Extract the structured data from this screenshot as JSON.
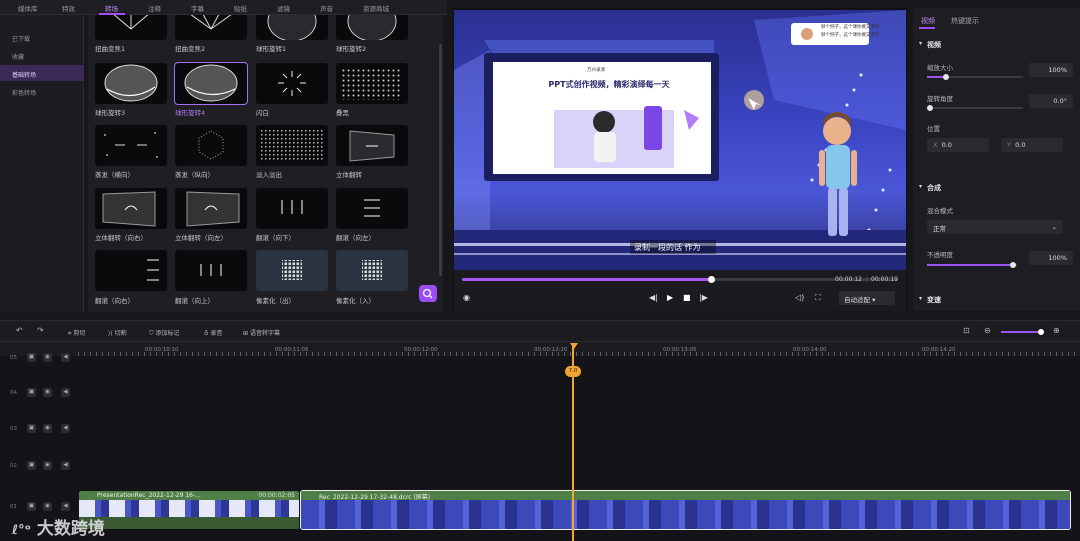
{
  "tabs": [
    "媒体库",
    "特效",
    "转场",
    "注释",
    "字幕",
    "贴纸",
    "滤镜",
    "声音",
    "资源商城"
  ],
  "categories": [
    "已下载",
    "收藏",
    "基础转场",
    "彩色转场"
  ],
  "transitions": [
    {
      "label": "扭曲变焦1"
    },
    {
      "label": "扭曲变焦2"
    },
    {
      "label": "球形旋转1"
    },
    {
      "label": "球形旋转2"
    },
    {
      "label": "球形旋转3"
    },
    {
      "label": "球形旋转4"
    },
    {
      "label": "闪白"
    },
    {
      "label": "叠黑"
    },
    {
      "label": "蒸发（横向）"
    },
    {
      "label": "蒸发（纵向）"
    },
    {
      "label": "淡入淡出"
    },
    {
      "label": "立体翻转"
    },
    {
      "label": "立体翻转（向右）"
    },
    {
      "label": "立体翻转（向左）"
    },
    {
      "label": "翻滚（向下）"
    },
    {
      "label": "翻滚（向左）"
    },
    {
      "label": "翻滚（向右）"
    },
    {
      "label": "翻滚（向上）"
    },
    {
      "label": "像素化（出）"
    },
    {
      "label": "像素化（入）"
    }
  ],
  "video": {
    "slide_title": "PPT式创作视频，精彩演绎每一天",
    "logo_text": "万兴录演",
    "subtitle": "录制一段的话 作为",
    "bubble_line1": "够个例子，这个课你要又求印",
    "bubble_line2": "够个例子，这个课你要又求印"
  },
  "playback": {
    "current": "00:00:12",
    "total": "00:00:19",
    "fit": "自动适配",
    "progress": 0.57
  },
  "inspector": {
    "tabs": [
      "视频",
      "热键提示"
    ],
    "section_video": "视频",
    "scale_label": "缩放大小",
    "scale_value": "100%",
    "rotate_label": "旋转角度",
    "rotate_value": "0.0°",
    "position_label": "位置",
    "x_label": "X",
    "x_value": "0.0",
    "y_label": "Y",
    "y_value": "0.0",
    "section_composite": "合成",
    "blend_label": "混合模式",
    "blend_value": "正常",
    "opacity_label": "不透明度",
    "opacity_value": "100%",
    "section_speed": "变速"
  },
  "toolbar": {
    "cut": "剪切",
    "split": "切割",
    "add_marker": "添加标记",
    "record": "录音",
    "speech_to_text": "语音转字幕"
  },
  "ruler": [
    "00:00:10:10",
    "00:00:11:05",
    "00:00:12:00",
    "00:00:12:20",
    "00:00:13:05",
    "00:00:14:00",
    "00:00:14:20"
  ],
  "tracks": [
    "05",
    "04",
    "03",
    "02",
    "01"
  ],
  "clips": [
    {
      "name": "PresentationRec_2022-12-29 16-...",
      "duration": "00:00:02:05"
    },
    {
      "name": "Rec_2022-12-29 17-32-48.dcrc (屏幕)"
    }
  ],
  "playhead_label": "7.0",
  "watermark": "大数跨境"
}
